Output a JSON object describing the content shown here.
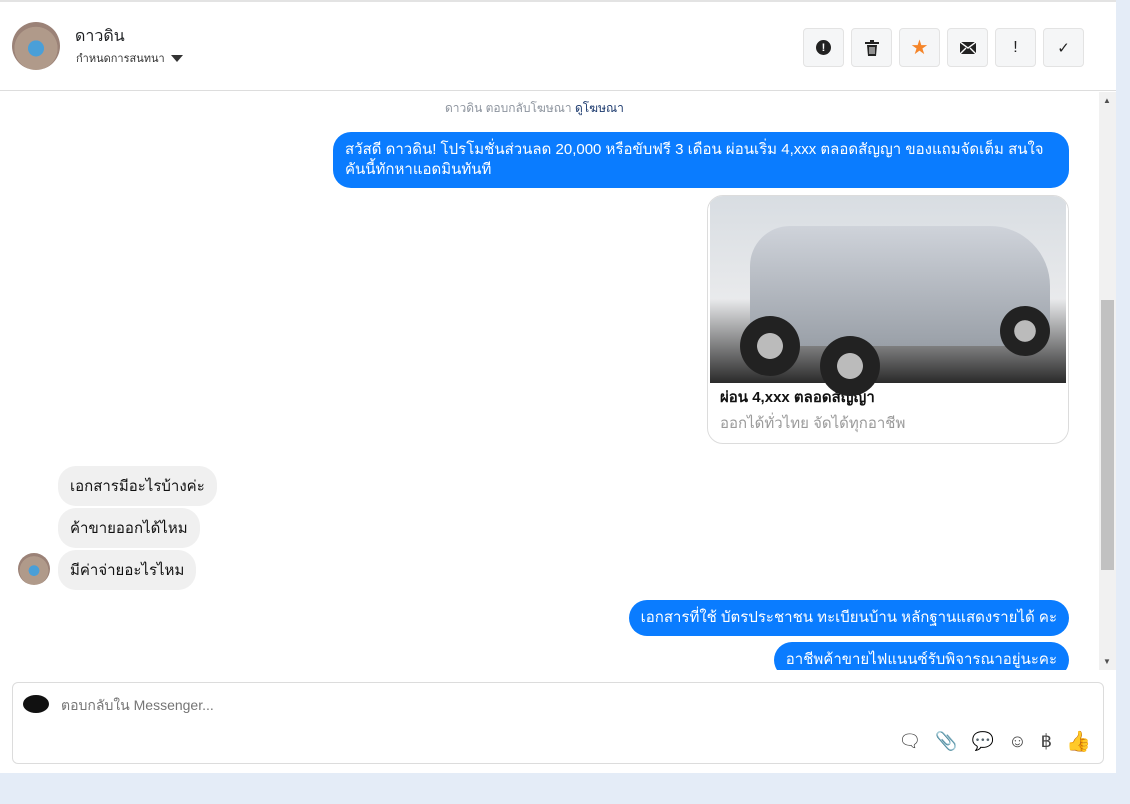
{
  "header": {
    "name": "ดาวดิน",
    "subtitle": "กำหนดการสนทนา",
    "actions": [
      "alert-circle",
      "trash",
      "star",
      "envelope",
      "exclamation",
      "check"
    ],
    "star_color": "#f5852a"
  },
  "conversation": {
    "note_text": "ดาวดิน ตอบกลับโฆษณา",
    "note_link": "ดูโฆษณา",
    "first_message": "สวัสดี ดาวดิน! โปรโมชั่นส่วนลด 20,000 หรือขับฟรี 3 เดือน ผ่อนเริ่ม 4,xxx ตลอดสัญญา ของแถมจัดเต็ม สนใจคันนี้ทักหาแอดมินทันที",
    "card": {
      "title": "ผ่อน 4,xxx ตลอดสัญญา",
      "subtitle": "ออกได้ทั่วไทย จัดได้ทุกอาชีพ"
    },
    "incoming": [
      "เอกสารมีอะไรบ้างค่ะ",
      "ค้าขายออกได้ไหม",
      "มีค่าจ่ายอะไรไหม"
    ],
    "outgoing": [
      "เอกสารที่ใช้ บัตรประชาชน ทะเบียนบ้าน หลักฐานแสดงรายได้ คะ",
      "อาชีพค้าขายไฟแนนซ์รับพิจารณาอยู่นะคะ"
    ],
    "bubble_color": "#0a7cff"
  },
  "composer": {
    "placeholder": "ตอบกลับใน Messenger...",
    "tools": [
      "saved-reply",
      "attach",
      "quick-reply",
      "emoji",
      "baht",
      "like"
    ],
    "baht_symbol": "฿"
  }
}
